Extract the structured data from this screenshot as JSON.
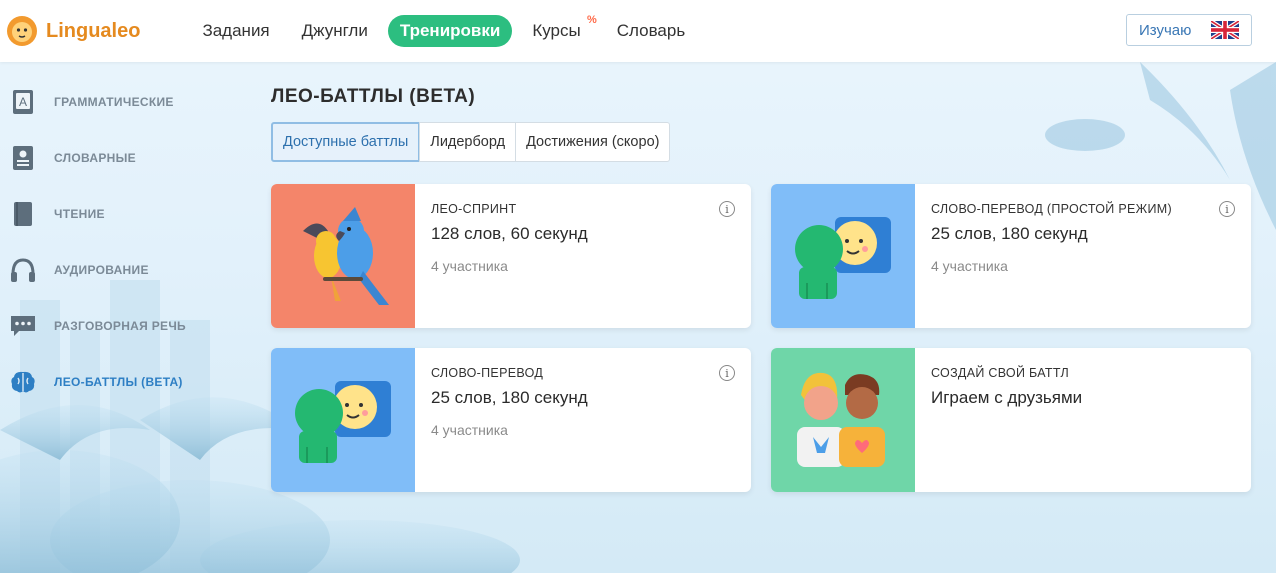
{
  "header": {
    "logo_text": "Lingualeo",
    "nav": [
      {
        "label": "Задания",
        "active": false
      },
      {
        "label": "Джунгли",
        "active": false
      },
      {
        "label": "Тренировки",
        "active": true
      },
      {
        "label": "Курсы",
        "active": false,
        "badge": "%"
      },
      {
        "label": "Словарь",
        "active": false
      }
    ],
    "lang_button": {
      "label": "Изучаю",
      "flag": "uk-flag-icon"
    }
  },
  "sidebar": {
    "items": [
      {
        "label": "ГРАММАТИЧЕСКИЕ",
        "icon": "grammar-book-icon",
        "active": false
      },
      {
        "label": "СЛОВАРНЫЕ",
        "icon": "vocabulary-card-icon",
        "active": false
      },
      {
        "label": "ЧТЕНИЕ",
        "icon": "book-icon",
        "active": false
      },
      {
        "label": "АУДИРОВАНИЕ",
        "icon": "headphones-icon",
        "active": false
      },
      {
        "label": "РАЗГОВОРНАЯ РЕЧЬ",
        "icon": "speech-bubble-icon",
        "active": false
      },
      {
        "label": "ЛЕО-БАТТЛЫ (BETA)",
        "icon": "brain-icon",
        "active": true
      }
    ]
  },
  "main": {
    "title": "ЛЕО-БАТТЛЫ (BETA)",
    "tabs": [
      {
        "label": "Доступные баттлы",
        "active": true
      },
      {
        "label": "Лидерборд",
        "active": false
      },
      {
        "label": "Достижения (скоро)",
        "active": false
      }
    ],
    "cards": [
      {
        "tag": "ЛЕО-СПРИНТ",
        "title": "128 слов, 60 секунд",
        "players": "4 участника",
        "image": "parrots-illustration",
        "bg": "#f4856a"
      },
      {
        "tag": "СЛОВО-ПЕРЕВОД (ПРОСТОЙ РЕЖИМ)",
        "title": "25 слов, 180 секунд",
        "players": "4 участника",
        "image": "chat-faces-illustration",
        "bg": "#80bdf8"
      },
      {
        "tag": "СЛОВО-ПЕРЕВОД",
        "title": "25 слов, 180 секунд",
        "players": "4 участника",
        "image": "chat-faces-illustration",
        "bg": "#80bdf8"
      },
      {
        "tag": "СОЗДАЙ СВОЙ БАТТЛ",
        "title": "Играем с друзьями",
        "players": "",
        "image": "friends-illustration",
        "bg": "#6fd6a8"
      }
    ]
  },
  "colors": {
    "brand_orange": "#e58a1f",
    "active_green": "#2cbe80",
    "active_blue": "#2e7fc4"
  }
}
